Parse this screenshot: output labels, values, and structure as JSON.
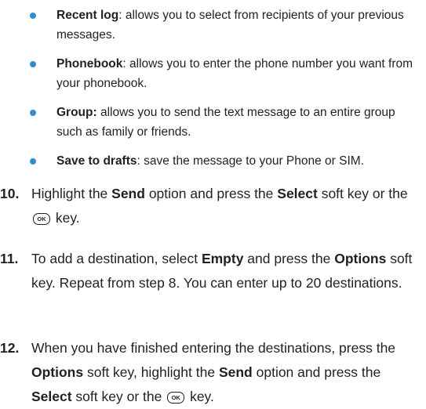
{
  "bullets": [
    {
      "term": "Recent log",
      "sep": ":",
      "desc": " allows you to select from recipients of your previous messages."
    },
    {
      "term": "Phonebook",
      "sep": ":",
      "desc": " allows you to enter the phone number you want from your phonebook."
    },
    {
      "term": "Group:",
      "sep": "",
      "desc": " allows you to send the text message to an entire group such as family or friends."
    },
    {
      "term": "Save to drafts",
      "sep": ":",
      "desc": " save the message to your Phone or SIM."
    }
  ],
  "steps": {
    "s10": {
      "num": "10.",
      "t1": "Highlight the ",
      "send": "Send",
      "t2": " option and press the ",
      "select": "Select",
      "t3": " soft key or the ",
      "t4": " key."
    },
    "s11": {
      "num": "11.",
      "t1": "To add a destination, select ",
      "empty": "Empty",
      "t2": " and press the ",
      "options": "Options",
      "t3": " soft key. Repeat from step 8. You can enter up to 20 destinations."
    },
    "s12": {
      "num": "12.",
      "t1": "When you have finished entering the destinations, press the ",
      "options": "Options",
      "t2": " soft key, highlight the ",
      "send": "Send",
      "t3": " option and press the ",
      "select": "Select",
      "t4": " soft key or the ",
      "t5": " key."
    }
  },
  "ok_key_label": "OK",
  "colors": {
    "bullet": "#2f8fce",
    "text": "#231f20"
  }
}
